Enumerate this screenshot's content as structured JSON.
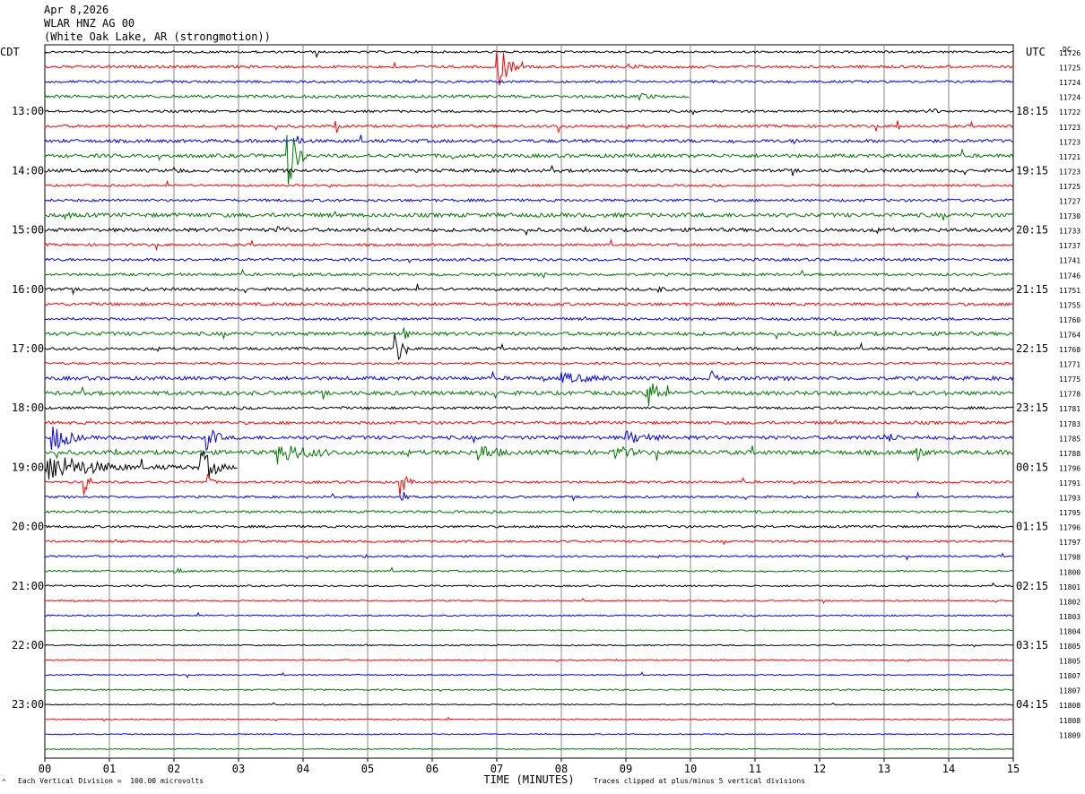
{
  "header": {
    "date": "Apr 8,2026",
    "station": "WLAR HNZ AG 00",
    "location": "(White Oak Lake, AR (strongmotion))"
  },
  "labels": {
    "left_tz": "CDT",
    "right_tz": "UTC",
    "dc_header": "DC",
    "x_axis_title": "TIME (MINUTES)",
    "scale_note": "Each Vertical Division =  100.00 microvolts",
    "clip_note": "Traces clipped at plus/minus 5 vertical divisions",
    "corner_mark": "^"
  },
  "chart_data": {
    "type": "line",
    "title": "WLAR HNZ AG 00",
    "xlabel": "TIME (MINUTES)",
    "xlim": [
      0,
      15
    ],
    "x_ticks": [
      "00",
      "01",
      "02",
      "03",
      "04",
      "05",
      "06",
      "07",
      "08",
      "09",
      "10",
      "11",
      "12",
      "13",
      "14",
      "15"
    ],
    "rows_per_hour": 4,
    "row_count": 48,
    "color_cycle": [
      "#000000",
      "#ff0000",
      "#0000ff",
      "#007a00"
    ],
    "left_hour_labels": [
      {
        "row": 4,
        "text": "13:00"
      },
      {
        "row": 8,
        "text": "14:00"
      },
      {
        "row": 12,
        "text": "15:00"
      },
      {
        "row": 16,
        "text": "16:00"
      },
      {
        "row": 20,
        "text": "17:00"
      },
      {
        "row": 24,
        "text": "18:00"
      },
      {
        "row": 28,
        "text": "19:00"
      },
      {
        "row": 32,
        "text": "20:00"
      },
      {
        "row": 36,
        "text": "21:00"
      },
      {
        "row": 40,
        "text": "22:00"
      },
      {
        "row": 44,
        "text": "23:00"
      }
    ],
    "right_hour_labels": [
      {
        "row": 4,
        "text": "18:15"
      },
      {
        "row": 8,
        "text": "19:15"
      },
      {
        "row": 12,
        "text": "20:15"
      },
      {
        "row": 16,
        "text": "21:15"
      },
      {
        "row": 20,
        "text": "22:15"
      },
      {
        "row": 24,
        "text": "23:15"
      },
      {
        "row": 28,
        "text": "00:15"
      },
      {
        "row": 32,
        "text": "01:15"
      },
      {
        "row": 36,
        "text": "02:15"
      },
      {
        "row": 40,
        "text": "03:15"
      },
      {
        "row": 44,
        "text": "04:15"
      }
    ],
    "dc_offsets": [
      "11726",
      "11725",
      "11724",
      "11724",
      "11722",
      "11723",
      "11723",
      "11721",
      "11723",
      "11725",
      "11727",
      "11730",
      "11733",
      "11737",
      "11741",
      "11746",
      "11751",
      "11755",
      "11760",
      "11764",
      "11768",
      "11771",
      "11775",
      "11778",
      "11781",
      "11783",
      "11785",
      "11788",
      "11796",
      "11791",
      "11793",
      "11795",
      "11796",
      "11797",
      "11798",
      "11800",
      "11801",
      "11802",
      "11803",
      "11804",
      "11805",
      "11805",
      "11807",
      "11807",
      "11808",
      "11808",
      "11809"
    ],
    "trace_noise": [
      1.2,
      1.5,
      1.3,
      1.6,
      1.3,
      1.5,
      1.8,
      2.0,
      1.8,
      1.2,
      1.5,
      2.2,
      2.0,
      1.4,
      1.5,
      1.5,
      1.6,
      1.6,
      1.4,
      2.0,
      1.5,
      1.2,
      2.0,
      2.2,
      1.4,
      1.6,
      2.0,
      2.4,
      2.5,
      1.3,
      1.2,
      1.3,
      1.3,
      1.2,
      1.0,
      1.0,
      0.9,
      0.8,
      0.8,
      0.7,
      0.7,
      0.7,
      0.7,
      0.8,
      0.6,
      0.6,
      0.6,
      0.6
    ],
    "events": [
      {
        "row": 0,
        "t": 4.2,
        "dur": 0.05,
        "amp": 16
      },
      {
        "row": 1,
        "t": 7.0,
        "dur": 0.45,
        "amp": 30
      },
      {
        "row": 1,
        "t": 9.0,
        "dur": 0.8,
        "amp": 4
      },
      {
        "row": 3,
        "t": 9.2,
        "dur": 0.8,
        "amp": 5
      },
      {
        "row": 4,
        "t": 13.7,
        "dur": 0.4,
        "amp": 6
      },
      {
        "row": 5,
        "t": 4.5,
        "dur": 0.1,
        "amp": 14
      },
      {
        "row": 5,
        "t": 7.95,
        "dur": 0.05,
        "amp": 18
      },
      {
        "row": 5,
        "t": 13.2,
        "dur": 0.06,
        "amp": 24
      },
      {
        "row": 6,
        "t": 3.9,
        "dur": 0.2,
        "amp": 12
      },
      {
        "row": 6,
        "t": 11.6,
        "dur": 0.8,
        "amp": 4
      },
      {
        "row": 7,
        "t": 3.75,
        "dur": 0.4,
        "amp": 45
      },
      {
        "row": 7,
        "t": 6.2,
        "dur": 0.8,
        "amp": 6
      },
      {
        "row": 8,
        "t": 2.0,
        "dur": 0.5,
        "amp": 5
      },
      {
        "row": 9,
        "t": 4.4,
        "dur": 0.05,
        "amp": 14
      },
      {
        "row": 11,
        "t": 0.3,
        "dur": 0.6,
        "amp": 5
      },
      {
        "row": 12,
        "t": 3.6,
        "dur": 0.6,
        "amp": 6
      },
      {
        "row": 15,
        "t": 7.7,
        "dur": 0.2,
        "amp": 6
      },
      {
        "row": 16,
        "t": 9.5,
        "dur": 0.3,
        "amp": 5
      },
      {
        "row": 19,
        "t": 5.55,
        "dur": 0.15,
        "amp": 18
      },
      {
        "row": 20,
        "t": 5.4,
        "dur": 0.3,
        "amp": 30
      },
      {
        "row": 22,
        "t": 8.0,
        "dur": 2.0,
        "amp": 7
      },
      {
        "row": 22,
        "t": 10.3,
        "dur": 0.5,
        "amp": 10
      },
      {
        "row": 23,
        "t": 9.3,
        "dur": 0.6,
        "amp": 22
      },
      {
        "row": 26,
        "t": 0.1,
        "dur": 0.8,
        "amp": 18
      },
      {
        "row": 26,
        "t": 2.5,
        "dur": 0.5,
        "amp": 16
      },
      {
        "row": 26,
        "t": 9.0,
        "dur": 1.5,
        "amp": 8
      },
      {
        "row": 26,
        "t": 13.0,
        "dur": 1.0,
        "amp": 6
      },
      {
        "row": 27,
        "t": 3.6,
        "dur": 1.6,
        "amp": 14
      },
      {
        "row": 27,
        "t": 6.7,
        "dur": 1.0,
        "amp": 12
      },
      {
        "row": 27,
        "t": 8.8,
        "dur": 1.0,
        "amp": 10
      },
      {
        "row": 27,
        "t": 13.5,
        "dur": 0.4,
        "amp": 10
      },
      {
        "row": 28,
        "t": 0.0,
        "dur": 2.2,
        "amp": 18
      },
      {
        "row": 28,
        "t": 2.4,
        "dur": 0.6,
        "amp": 25
      },
      {
        "row": 28,
        "t": 3.9,
        "dur": 0.6,
        "amp": 20
      },
      {
        "row": 28,
        "t": 5.2,
        "dur": 0.6,
        "amp": 16
      },
      {
        "row": 29,
        "t": 0.6,
        "dur": 0.3,
        "amp": 16
      },
      {
        "row": 29,
        "t": 2.5,
        "dur": 0.2,
        "amp": 18
      },
      {
        "row": 29,
        "t": 5.5,
        "dur": 0.3,
        "amp": 18
      },
      {
        "row": 30,
        "t": 5.5,
        "dur": 0.2,
        "amp": 14
      },
      {
        "row": 34,
        "t": 4.9,
        "dur": 0.2,
        "amp": 4
      },
      {
        "row": 35,
        "t": 2.0,
        "dur": 0.6,
        "amp": 4
      }
    ]
  }
}
